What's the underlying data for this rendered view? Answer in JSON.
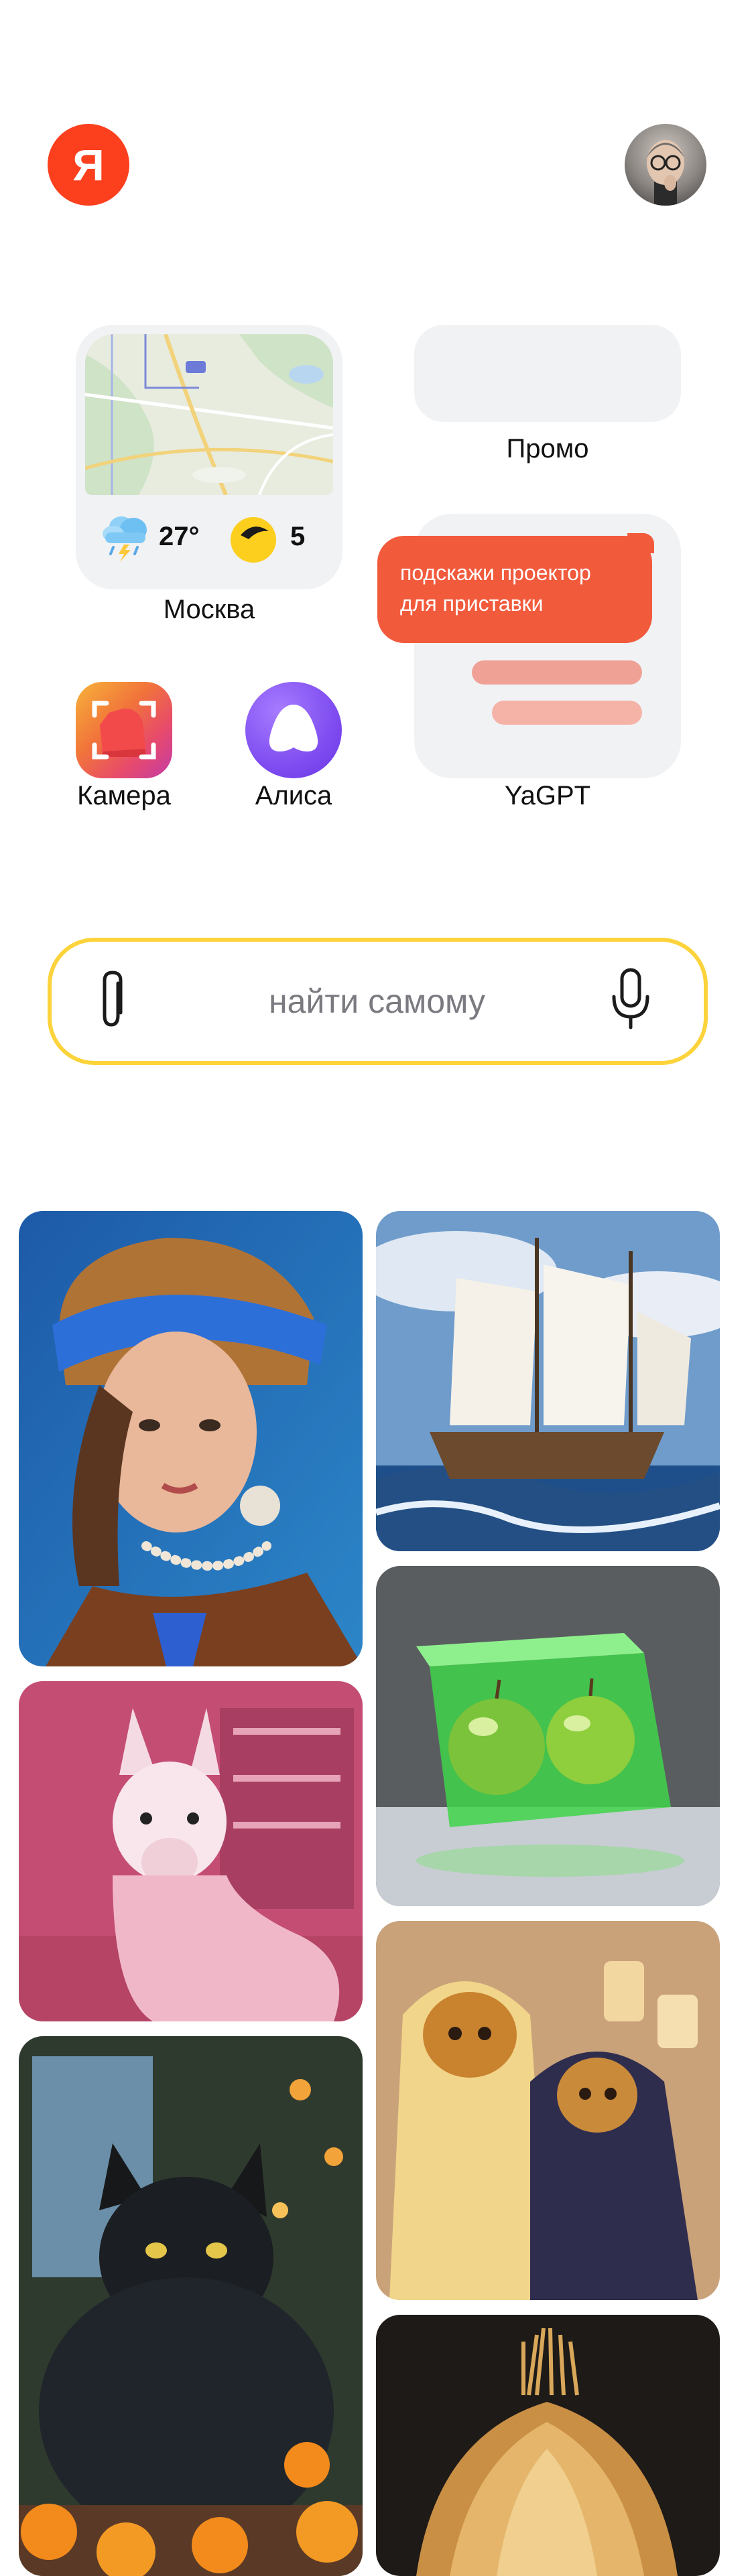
{
  "header": {
    "logo_text": "Я",
    "logo_color": "#fc3f1d"
  },
  "widgets": {
    "map": {
      "temperature": "27°",
      "traffic_score": "5",
      "city": "Москва",
      "weather_icon": "rain-thunder-cloud-icon",
      "traffic_icon": "traffic-level-icon"
    },
    "promo": {
      "label": "Промо"
    },
    "gpt": {
      "label": "YaGPT",
      "bubble_text": "подскажи проектор для приставки"
    },
    "apps": [
      {
        "label": "Камера",
        "icon": "camera-app-icon"
      },
      {
        "label": "Алиса",
        "icon": "alice-assistant-icon"
      }
    ]
  },
  "search": {
    "placeholder": "найти самому",
    "attach_icon": "paperclip-icon",
    "voice_icon": "microphone-icon",
    "border_color": "#fcd33b"
  },
  "feed": {
    "images": [
      "girl-with-pearl-earring-image",
      "sailing-ship-image",
      "green-apples-in-cube-image",
      "pink-llama-image",
      "black-cat-with-tangerines-image",
      "knitted-cats-image",
      "onion-image"
    ]
  }
}
